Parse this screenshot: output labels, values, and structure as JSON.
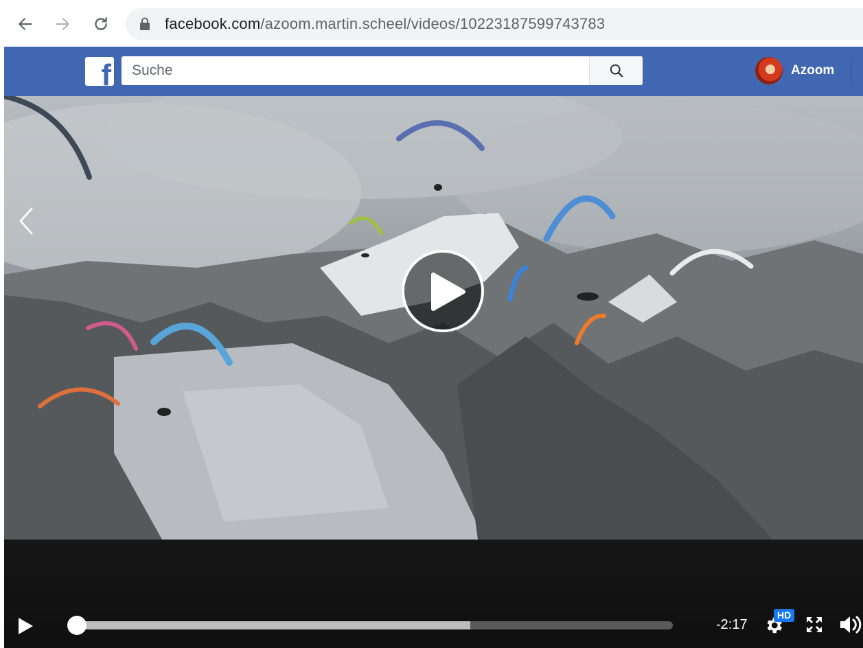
{
  "browser": {
    "url_domain": "facebook.com",
    "url_path": "/azoom.martin.scheel/videos/10223187599743783",
    "back_icon": "arrow-left-icon",
    "forward_icon": "arrow-right-icon",
    "reload_icon": "reload-icon",
    "lock_icon": "lock-icon"
  },
  "header": {
    "logo_letter": "f",
    "search_placeholder": "Suche",
    "search_icon": "search-icon",
    "profile_name": "Azoom",
    "brand_color": "#4267b2"
  },
  "video": {
    "play_state": "paused",
    "progress_fraction": 0.0,
    "buffered_fraction": 0.66,
    "time_remaining": "-2:17",
    "quality_badge": "HD"
  }
}
